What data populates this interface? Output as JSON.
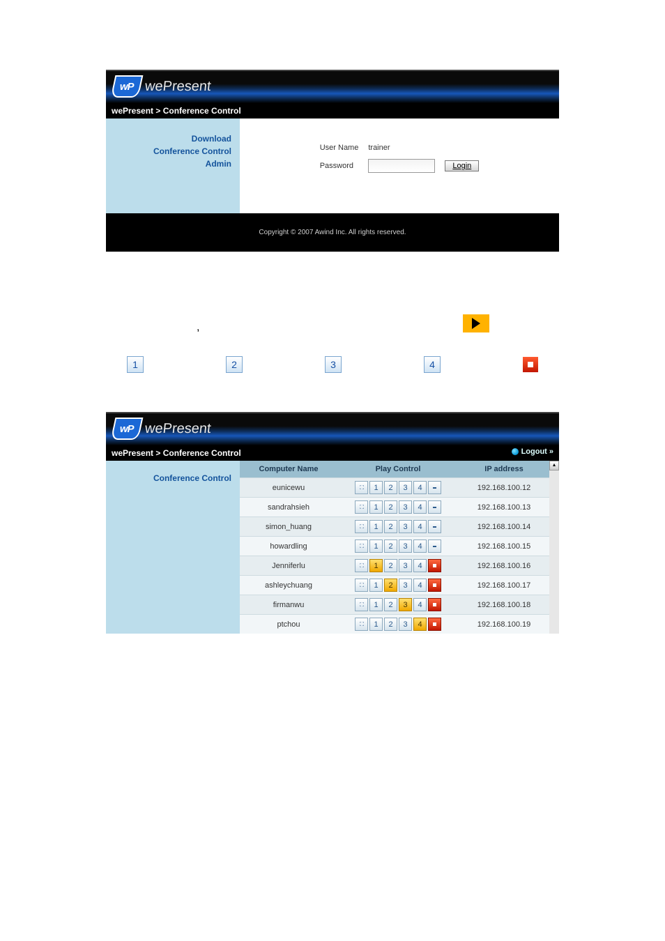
{
  "brand": "wePresent",
  "logo_letters": "wP",
  "breadcrumb": "wePresent > Conference Control",
  "side_nav": {
    "download": "Download",
    "conference": "Conference Control",
    "admin": "Admin"
  },
  "login": {
    "user_label": "User Name",
    "user_value": "trainer",
    "pass_label": "Password",
    "pass_value": "",
    "button": "Login"
  },
  "copyright": "Copyright © 2007 Awind Inc. All rights reserved.",
  "mid_symbols": {
    "n1": "1",
    "n2": "2",
    "n3": "3",
    "n4": "4",
    "comma": ","
  },
  "logout": "Logout »",
  "table": {
    "headers": {
      "name": "Computer Name",
      "ctrl": "Play Control",
      "ip": "IP address"
    },
    "rows": [
      {
        "name": "eunicewu",
        "ip": "192.168.100.12",
        "active": 0,
        "stop": false
      },
      {
        "name": "sandrahsieh",
        "ip": "192.168.100.13",
        "active": 0,
        "stop": false
      },
      {
        "name": "simon_huang",
        "ip": "192.168.100.14",
        "active": 0,
        "stop": false
      },
      {
        "name": "howardling",
        "ip": "192.168.100.15",
        "active": 0,
        "stop": false
      },
      {
        "name": "Jenniferlu",
        "ip": "192.168.100.16",
        "active": 1,
        "stop": true
      },
      {
        "name": "ashleychuang",
        "ip": "192.168.100.17",
        "active": 2,
        "stop": true
      },
      {
        "name": "firmanwu",
        "ip": "192.168.100.18",
        "active": 3,
        "stop": true
      },
      {
        "name": "ptchou",
        "ip": "192.168.100.19",
        "active": 4,
        "stop": true
      }
    ]
  }
}
